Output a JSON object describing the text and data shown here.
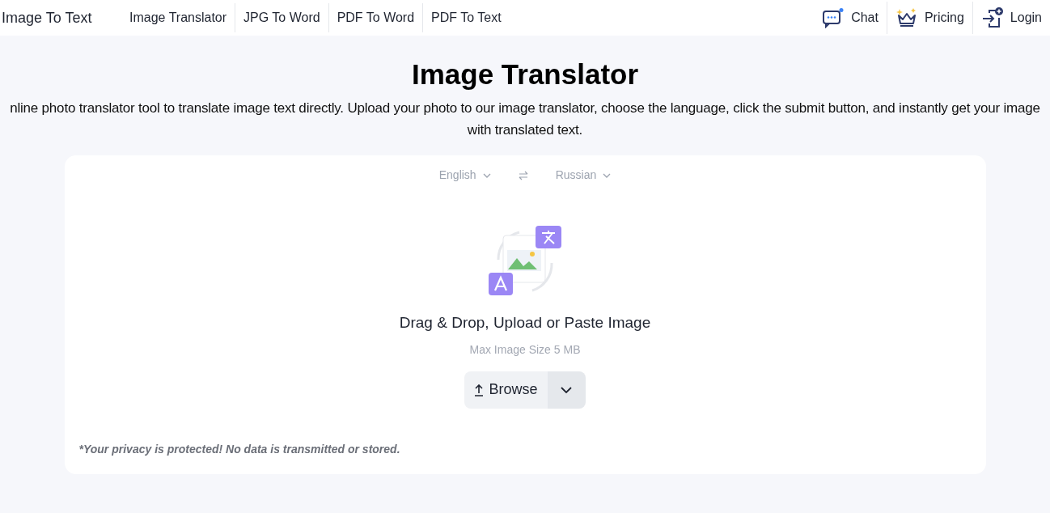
{
  "header": {
    "brand": "Image To Text",
    "nav": [
      {
        "label": "Image Translator"
      },
      {
        "label": "JPG To Word"
      },
      {
        "label": "PDF To Word"
      },
      {
        "label": "PDF To Text"
      }
    ],
    "actions": [
      {
        "kind": "chat",
        "label": "Chat"
      },
      {
        "kind": "pricing",
        "label": "Pricing"
      },
      {
        "kind": "login",
        "label": "Login"
      }
    ]
  },
  "title": "Image Translator",
  "description": "nline photo translator tool to translate image text directly. Upload your photo to our image translator, choose the language, click the submit button, and instantly get your image with translated text.",
  "card": {
    "source_language": "English",
    "target_language": "Russian",
    "prompt": "Drag & Drop, Upload or Paste Image",
    "limit": "Max Image Size 5 MB",
    "browse": "Browse",
    "privacy": "*Your privacy is protected! No data is transmitted or stored."
  }
}
